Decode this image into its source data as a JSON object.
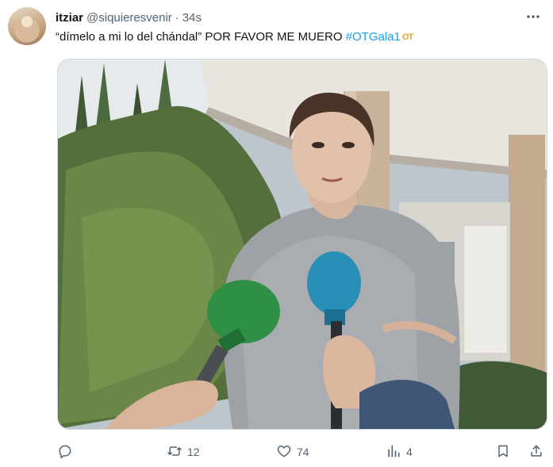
{
  "tweet": {
    "author_name": "itziar",
    "author_handle": "@siquieresvenir",
    "separator": "·",
    "timestamp": "34s",
    "text_before": "“dímelo a mi lo del chándal” POR FAVOR ME MUERO ",
    "hashtag": "#OTGala1",
    "hashtag_emoji": "OT"
  },
  "actions": {
    "reply_count": "",
    "retweet_count": "12",
    "like_count": "74",
    "views_count": "4"
  },
  "colors": {
    "accent": "#1d9bf0",
    "secondary_text": "#536471",
    "primary_text": "#0f1419"
  },
  "icons": {
    "more": "more-icon",
    "reply": "reply-icon",
    "retweet": "retweet-icon",
    "like": "heart-icon",
    "views": "views-icon",
    "bookmark": "bookmark-icon",
    "share": "share-icon"
  }
}
